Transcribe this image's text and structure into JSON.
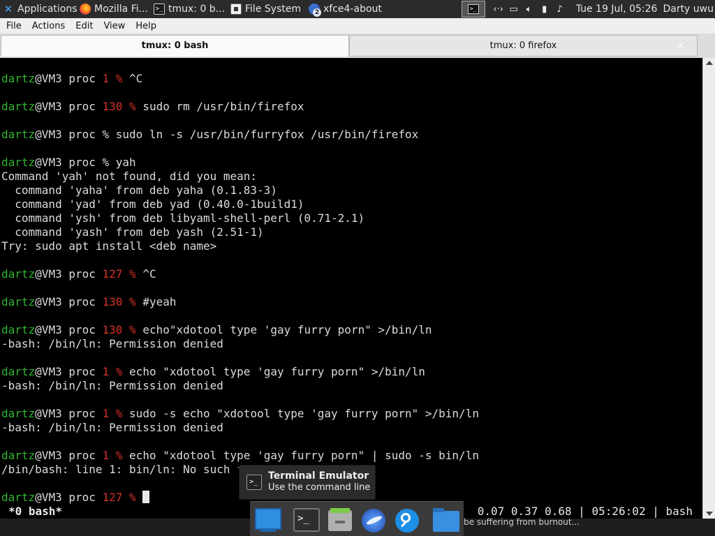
{
  "panel": {
    "apps_label": "Applications",
    "tasks": [
      "Mozilla Fi...",
      "tmux: 0 b...",
      "File System",
      "xfce4-about"
    ],
    "about_badge": "2",
    "clock": "Tue 19 Jul, 05:26",
    "user": "Darty uwu",
    "icons": [
      "applications-icon",
      "firefox-icon",
      "terminal-icon",
      "file-system-icon",
      "xfce4-about-icon",
      "terminal-tray-icon",
      "network-icon",
      "display-icon",
      "volume-icon",
      "battery-icon",
      "notification-bell-icon"
    ]
  },
  "menubar": [
    "File",
    "Actions",
    "Edit",
    "View",
    "Help"
  ],
  "tabs": [
    "tmux: 0 bash",
    "tmux: 0 firefox"
  ],
  "tab_close": "×",
  "terminal": {
    "user": "dartz",
    "host": "@VM3 proc ",
    "codes": [
      "1",
      "130",
      "127",
      "130",
      "130",
      "1",
      "1",
      "1",
      "127"
    ],
    "sep": "% ",
    "cmds": [
      "^C",
      "sudo rm /usr/bin/firefox",
      "sudo ln -s /usr/bin/furryfox /usr/bin/firefox",
      "yah",
      "^C",
      "#yeah",
      "echo\"xdotool type 'gay furry porn\" >/bin/ln",
      "echo \"xdotool type 'gay furry porn\" >/bin/ln",
      "sudo -s echo \"xdotool type 'gay furry porn\" >/bin/ln",
      "echo \"xdotool type 'gay furry porn\" | sudo -s bin/ln"
    ],
    "out": [
      "Command 'yah' not found, did you mean:",
      "  command 'yaha' from deb yaha (0.1.83-3)",
      "  command 'yad' from deb yad (0.40.0-1build1)",
      "  command 'ysh' from deb libyaml-shell-perl (0.71-2.1)",
      "  command 'yash' from deb yash (2.51-1)",
      "Try: sudo apt install <deb name>",
      "-bash: /bin/ln: Permission denied",
      "/bin/bash: line 1: bin/ln: No such file or directory"
    ]
  },
  "tmux": {
    "window": "*0 bash*",
    "status": "0.07 0.37 0.68 | 05:26:02 | bash"
  },
  "bottom_text": "be suffering from burnout...",
  "tooltip": {
    "title": "Terminal Emulator",
    "subtitle": "Use the command line"
  },
  "dock": [
    "desktop-icon",
    "terminal-icon",
    "file-manager-icon",
    "web-browser-icon",
    "app-finder-icon",
    "folder-icon"
  ]
}
